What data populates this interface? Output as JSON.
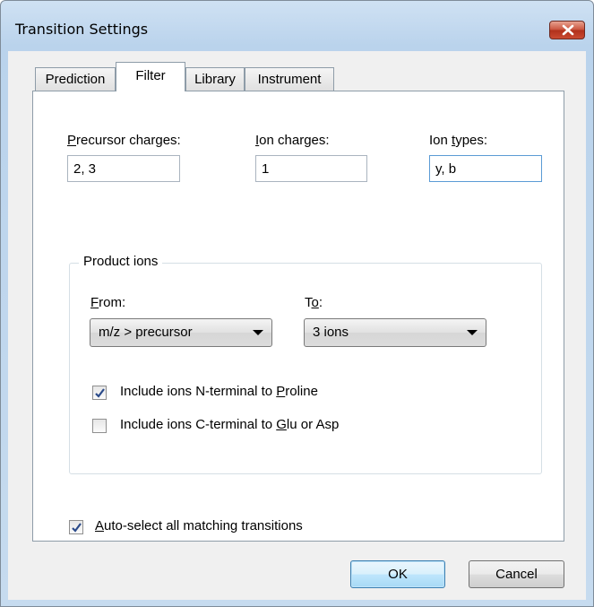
{
  "window": {
    "title": "Transition Settings"
  },
  "tabs": [
    {
      "label": "Prediction",
      "active": false
    },
    {
      "label": "Filter",
      "active": true
    },
    {
      "label": "Library",
      "active": false
    },
    {
      "label": "Instrument",
      "active": false
    }
  ],
  "filter": {
    "precursor_charges": {
      "label_pre": "",
      "label_key": "P",
      "label_post": "recursor charges:",
      "value": "2, 3"
    },
    "ion_charges": {
      "label_pre": "",
      "label_key": "I",
      "label_post": "on charges:",
      "value": "1"
    },
    "ion_types": {
      "label_pre": "Ion ",
      "label_key": "t",
      "label_post": "ypes:",
      "value": "y, b"
    },
    "product_ions": {
      "title": "Product ions",
      "from": {
        "label_pre": "",
        "label_key": "F",
        "label_post": "rom:",
        "selected": "m/z > precursor"
      },
      "to": {
        "label_pre": "T",
        "label_key": "o",
        "label_post": ":",
        "selected": "3 ions"
      },
      "n_terminal_proline": {
        "label_pre": "Include ions N-terminal to ",
        "label_key": "P",
        "label_post": "roline",
        "checked": true
      },
      "c_terminal_glu_asp": {
        "label_pre": "Include ions C-terminal to ",
        "label_key": "G",
        "label_post": "lu or Asp",
        "checked": false
      }
    },
    "auto_select": {
      "label_pre": "",
      "label_key": "A",
      "label_post": "uto-select all matching transitions",
      "checked": true
    }
  },
  "buttons": {
    "ok": "OK",
    "cancel": "Cancel"
  },
  "colors": {
    "check": "#2a4a8a",
    "focus_border": "#5b9bd5",
    "close_button": "#c9513b"
  }
}
